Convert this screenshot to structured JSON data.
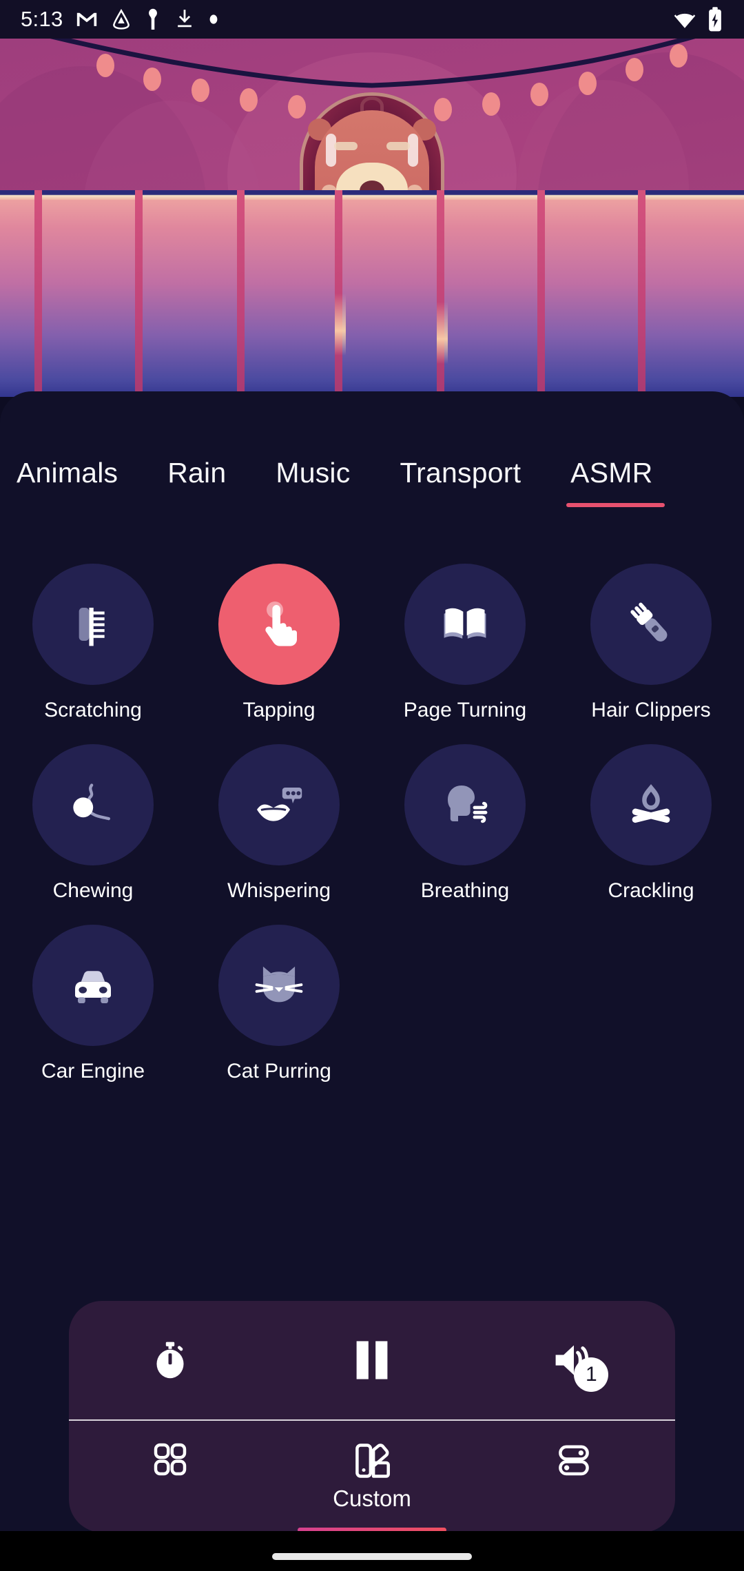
{
  "status_bar": {
    "time": "5:13",
    "left_icons": [
      "gmail-icon",
      "drive-icon",
      "key-icon",
      "download-icon",
      "dot-icon"
    ],
    "right_icons": [
      "wifi-icon",
      "battery-charging-icon"
    ]
  },
  "hero": {
    "illustration": "hedgehog-behind-fence-with-string-lights",
    "colors": {
      "sky": "#a8417f",
      "fence_post": "#d4527c",
      "hedgehog_body": "#cf6f67",
      "hedgehog_spikes": "#6e1b3e"
    }
  },
  "tabs": [
    {
      "label": "Animals",
      "active": false
    },
    {
      "label": "Rain",
      "active": false
    },
    {
      "label": "Music",
      "active": false
    },
    {
      "label": "Transport",
      "active": false
    },
    {
      "label": "ASMR",
      "active": true
    }
  ],
  "sounds": [
    {
      "label": "Scratching",
      "icon": "comb-icon",
      "selected": false
    },
    {
      "label": "Tapping",
      "icon": "tapping-hand-icon",
      "selected": true
    },
    {
      "label": "Page Turning",
      "icon": "open-book-icon",
      "selected": false
    },
    {
      "label": "Hair Clippers",
      "icon": "hair-clipper-icon",
      "selected": false
    },
    {
      "label": "Chewing",
      "icon": "chewing-gum-icon",
      "selected": false
    },
    {
      "label": "Whispering",
      "icon": "lips-speech-icon",
      "selected": false
    },
    {
      "label": "Breathing",
      "icon": "head-breath-icon",
      "selected": false
    },
    {
      "label": "Crackling",
      "icon": "campfire-icon",
      "selected": false
    },
    {
      "label": "Car Engine",
      "icon": "car-icon",
      "selected": false
    },
    {
      "label": "Cat Purring",
      "icon": "cat-face-icon",
      "selected": false
    }
  ],
  "player_controls": [
    {
      "name": "timer",
      "icon": "stopwatch-icon"
    },
    {
      "name": "pause",
      "icon": "pause-icon"
    },
    {
      "name": "volume",
      "icon": "volume-icon",
      "badge": "1"
    }
  ],
  "bottom_nav": [
    {
      "label": "",
      "icon": "grid-icon",
      "active": false
    },
    {
      "label": "Custom",
      "icon": "palette-icon",
      "active": true
    },
    {
      "label": "",
      "icon": "toggles-icon",
      "active": false
    }
  ],
  "accent_colors": {
    "tab_underline": "#ef5472",
    "selected_bubble": "#ee5f6f",
    "bubble": "#232150",
    "panel": "#111029",
    "dock": "#2e1b3b",
    "nav_underline_start": "#d6428f",
    "nav_underline_end": "#ef5060"
  }
}
